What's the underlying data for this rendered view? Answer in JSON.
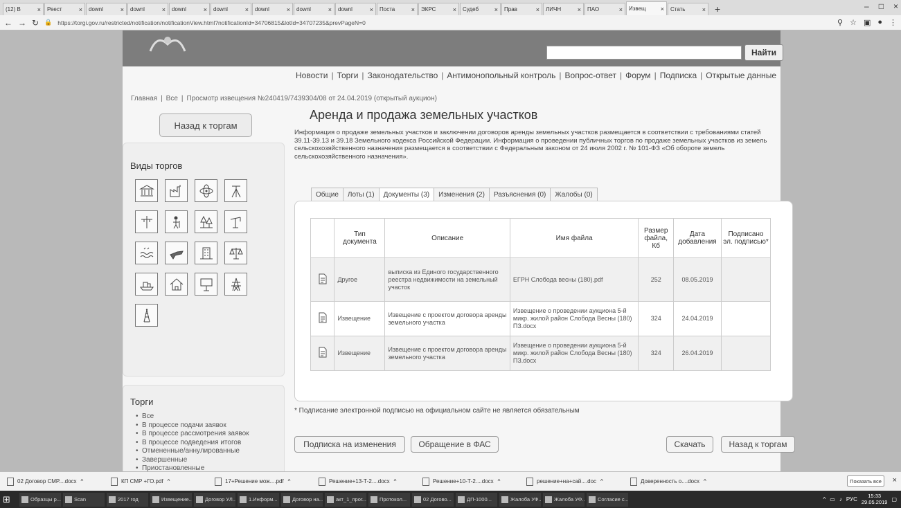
{
  "browser": {
    "tabs": [
      {
        "label": "(12) В"
      },
      {
        "label": "Реест"
      },
      {
        "label": "downl"
      },
      {
        "label": "downl"
      },
      {
        "label": "downl"
      },
      {
        "label": "downl"
      },
      {
        "label": "downl"
      },
      {
        "label": "downl"
      },
      {
        "label": "downl"
      },
      {
        "label": "Поста"
      },
      {
        "label": "ЭКРС"
      },
      {
        "label": "Судеб"
      },
      {
        "label": "Прав"
      },
      {
        "label": "ЛИЧН"
      },
      {
        "label": "ПАО"
      },
      {
        "label": "Извещ"
      },
      {
        "label": "Стать"
      }
    ],
    "new_tab": "+",
    "window_controls": {
      "minimize": "–",
      "maximize": "□",
      "close": "×"
    },
    "url": "https://torgi.gov.ru/restricted/notification/notificationView.html?notificationId=34706815&lotId=34707235&prevPageN=0"
  },
  "site": {
    "search_button": "Найти",
    "nav": [
      "Новости",
      "Торги",
      "Законодательство",
      "Антимонопольный контроль",
      "Вопрос-ответ",
      "Форум",
      "Подписка",
      "Открытые данные"
    ],
    "breadcrumbs": [
      "Главная",
      "Все",
      "Просмотр извещения №240419/7439304/08 от 24.04.2019 (открытый аукцион)"
    ]
  },
  "sidebar": {
    "back_button": "Назад к торгам",
    "kinds_title": "Виды торгов",
    "torgi_title": "Торги",
    "torgi_items": [
      "Все",
      "В процессе подачи заявок",
      "В процессе рассмотрения заявок",
      "В процессе подведения итогов",
      "Отмененные/аннулированные",
      "Завершенные",
      "Приостановленные"
    ]
  },
  "main": {
    "title": "Аренда и продажа земельных участков",
    "intro": "Информация о продаже земельных участков и заключении договоров аренды земельных участков размещается в соответствии с требованиями статей 39.11-39.13 и 39.18 Земельного кодекса Российской Федерации. Информация о проведении публичных торгов по продаже земельных участков из земель сельскохозяйственного назначения размещается в соответствии с Федеральным законом от 24 июля 2002 г. № 101-ФЗ «Об обороте земель сельскохозяйственного назначения».",
    "tabs": [
      "Общие",
      "Лоты (1)",
      "Документы (3)",
      "Изменения (2)",
      "Разъяснения (0)",
      "Жалобы (0)"
    ],
    "table": {
      "headers": [
        "Тип документа",
        "Описание",
        "Имя файла",
        "Размер файла, Кб",
        "Дата добавления",
        "Подписано эл. подписью*"
      ],
      "rows": [
        {
          "type": "Другое",
          "description": "выписка из Единого государственного реестра недвижимости на земельный участок",
          "file": "ЕГРН Слобода весны (180).pdf",
          "size": "252",
          "date": "08.05.2019",
          "signed": ""
        },
        {
          "type": "Извещение",
          "description": "Извещение с проектом договора аренды земельного участка",
          "file": "Извещение о проведении аукциона 5-й микр. жилой район Слобода Весны (180) ПЗ.docx",
          "size": "324",
          "date": "24.04.2019",
          "signed": ""
        },
        {
          "type": "Извещение",
          "description": "Извещение с проектом договора аренды земельного участка",
          "file": "Извещение о проведении аукциона 5-й микр. жилой район Слобода Весны (180) ПЗ.docx",
          "size": "324",
          "date": "26.04.2019",
          "signed": ""
        }
      ]
    },
    "footnote": "* Подписание электронной подписью на официальном сайте не является обязательным",
    "buttons": {
      "subscribe": "Подписка на изменения",
      "fas": "Обращение в ФАС",
      "download": "Скачать",
      "back": "Назад к торгам"
    }
  },
  "downloads": {
    "items": [
      "02 Договор СМР....docx",
      "КП СМР +ГО.pdf",
      "17+Решение мож....pdf",
      "Решение+13-Т-2....docx",
      "Решение+10-Т-2....docx",
      "решение+на+сай....doc",
      "Доверенность о....docx"
    ],
    "show_all": "Показать все",
    "close": "×"
  },
  "taskbar": {
    "items": [
      "Образцы р...",
      "Scan",
      "2017 год",
      "Извещение...",
      "Договор УЛ...",
      "1.Информ...",
      "Договор на...",
      "акт_1_прог...",
      "Протокол...",
      "02 Догово...",
      "ДП-1000...",
      "Жалоба УФ...",
      "Жалоба УФ...",
      "Согласие с..."
    ],
    "lang": "РУС",
    "time": "15:33",
    "date": "29.05.2019"
  }
}
